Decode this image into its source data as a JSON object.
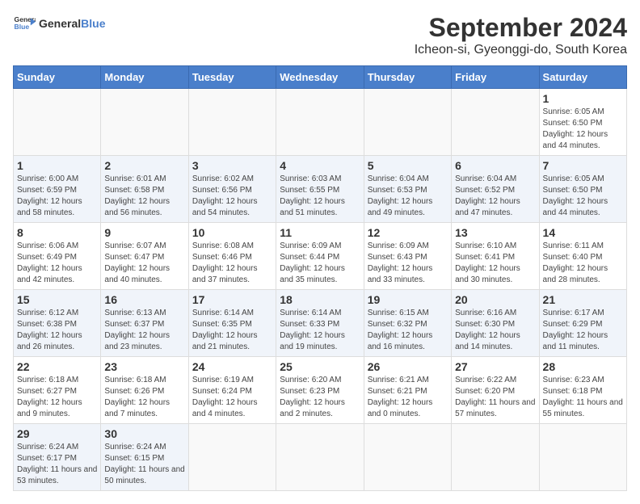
{
  "header": {
    "logo_line1": "General",
    "logo_line2": "Blue",
    "title": "September 2024",
    "subtitle": "Icheon-si, Gyeonggi-do, South Korea"
  },
  "calendar": {
    "days_of_week": [
      "Sunday",
      "Monday",
      "Tuesday",
      "Wednesday",
      "Thursday",
      "Friday",
      "Saturday"
    ],
    "weeks": [
      [
        {
          "day": "",
          "empty": true
        },
        {
          "day": "",
          "empty": true
        },
        {
          "day": "",
          "empty": true
        },
        {
          "day": "",
          "empty": true
        },
        {
          "day": "",
          "empty": true
        },
        {
          "day": "",
          "empty": true
        },
        {
          "day": "1",
          "sunrise": "Sunrise: 6:05 AM",
          "sunset": "Sunset: 6:50 PM",
          "daylight": "Daylight: 12 hours and 44 minutes."
        }
      ],
      [
        {
          "day": "1",
          "sunrise": "Sunrise: 6:00 AM",
          "sunset": "Sunset: 6:59 PM",
          "daylight": "Daylight: 12 hours and 58 minutes."
        },
        {
          "day": "2",
          "sunrise": "Sunrise: 6:01 AM",
          "sunset": "Sunset: 6:58 PM",
          "daylight": "Daylight: 12 hours and 56 minutes."
        },
        {
          "day": "3",
          "sunrise": "Sunrise: 6:02 AM",
          "sunset": "Sunset: 6:56 PM",
          "daylight": "Daylight: 12 hours and 54 minutes."
        },
        {
          "day": "4",
          "sunrise": "Sunrise: 6:03 AM",
          "sunset": "Sunset: 6:55 PM",
          "daylight": "Daylight: 12 hours and 51 minutes."
        },
        {
          "day": "5",
          "sunrise": "Sunrise: 6:04 AM",
          "sunset": "Sunset: 6:53 PM",
          "daylight": "Daylight: 12 hours and 49 minutes."
        },
        {
          "day": "6",
          "sunrise": "Sunrise: 6:04 AM",
          "sunset": "Sunset: 6:52 PM",
          "daylight": "Daylight: 12 hours and 47 minutes."
        },
        {
          "day": "7",
          "sunrise": "Sunrise: 6:05 AM",
          "sunset": "Sunset: 6:50 PM",
          "daylight": "Daylight: 12 hours and 44 minutes."
        }
      ],
      [
        {
          "day": "8",
          "sunrise": "Sunrise: 6:06 AM",
          "sunset": "Sunset: 6:49 PM",
          "daylight": "Daylight: 12 hours and 42 minutes."
        },
        {
          "day": "9",
          "sunrise": "Sunrise: 6:07 AM",
          "sunset": "Sunset: 6:47 PM",
          "daylight": "Daylight: 12 hours and 40 minutes."
        },
        {
          "day": "10",
          "sunrise": "Sunrise: 6:08 AM",
          "sunset": "Sunset: 6:46 PM",
          "daylight": "Daylight: 12 hours and 37 minutes."
        },
        {
          "day": "11",
          "sunrise": "Sunrise: 6:09 AM",
          "sunset": "Sunset: 6:44 PM",
          "daylight": "Daylight: 12 hours and 35 minutes."
        },
        {
          "day": "12",
          "sunrise": "Sunrise: 6:09 AM",
          "sunset": "Sunset: 6:43 PM",
          "daylight": "Daylight: 12 hours and 33 minutes."
        },
        {
          "day": "13",
          "sunrise": "Sunrise: 6:10 AM",
          "sunset": "Sunset: 6:41 PM",
          "daylight": "Daylight: 12 hours and 30 minutes."
        },
        {
          "day": "14",
          "sunrise": "Sunrise: 6:11 AM",
          "sunset": "Sunset: 6:40 PM",
          "daylight": "Daylight: 12 hours and 28 minutes."
        }
      ],
      [
        {
          "day": "15",
          "sunrise": "Sunrise: 6:12 AM",
          "sunset": "Sunset: 6:38 PM",
          "daylight": "Daylight: 12 hours and 26 minutes."
        },
        {
          "day": "16",
          "sunrise": "Sunrise: 6:13 AM",
          "sunset": "Sunset: 6:37 PM",
          "daylight": "Daylight: 12 hours and 23 minutes."
        },
        {
          "day": "17",
          "sunrise": "Sunrise: 6:14 AM",
          "sunset": "Sunset: 6:35 PM",
          "daylight": "Daylight: 12 hours and 21 minutes."
        },
        {
          "day": "18",
          "sunrise": "Sunrise: 6:14 AM",
          "sunset": "Sunset: 6:33 PM",
          "daylight": "Daylight: 12 hours and 19 minutes."
        },
        {
          "day": "19",
          "sunrise": "Sunrise: 6:15 AM",
          "sunset": "Sunset: 6:32 PM",
          "daylight": "Daylight: 12 hours and 16 minutes."
        },
        {
          "day": "20",
          "sunrise": "Sunrise: 6:16 AM",
          "sunset": "Sunset: 6:30 PM",
          "daylight": "Daylight: 12 hours and 14 minutes."
        },
        {
          "day": "21",
          "sunrise": "Sunrise: 6:17 AM",
          "sunset": "Sunset: 6:29 PM",
          "daylight": "Daylight: 12 hours and 11 minutes."
        }
      ],
      [
        {
          "day": "22",
          "sunrise": "Sunrise: 6:18 AM",
          "sunset": "Sunset: 6:27 PM",
          "daylight": "Daylight: 12 hours and 9 minutes."
        },
        {
          "day": "23",
          "sunrise": "Sunrise: 6:18 AM",
          "sunset": "Sunset: 6:26 PM",
          "daylight": "Daylight: 12 hours and 7 minutes."
        },
        {
          "day": "24",
          "sunrise": "Sunrise: 6:19 AM",
          "sunset": "Sunset: 6:24 PM",
          "daylight": "Daylight: 12 hours and 4 minutes."
        },
        {
          "day": "25",
          "sunrise": "Sunrise: 6:20 AM",
          "sunset": "Sunset: 6:23 PM",
          "daylight": "Daylight: 12 hours and 2 minutes."
        },
        {
          "day": "26",
          "sunrise": "Sunrise: 6:21 AM",
          "sunset": "Sunset: 6:21 PM",
          "daylight": "Daylight: 12 hours and 0 minutes."
        },
        {
          "day": "27",
          "sunrise": "Sunrise: 6:22 AM",
          "sunset": "Sunset: 6:20 PM",
          "daylight": "Daylight: 11 hours and 57 minutes."
        },
        {
          "day": "28",
          "sunrise": "Sunrise: 6:23 AM",
          "sunset": "Sunset: 6:18 PM",
          "daylight": "Daylight: 11 hours and 55 minutes."
        }
      ],
      [
        {
          "day": "29",
          "sunrise": "Sunrise: 6:24 AM",
          "sunset": "Sunset: 6:17 PM",
          "daylight": "Daylight: 11 hours and 53 minutes."
        },
        {
          "day": "30",
          "sunrise": "Sunrise: 6:24 AM",
          "sunset": "Sunset: 6:15 PM",
          "daylight": "Daylight: 11 hours and 50 minutes."
        },
        {
          "day": "",
          "empty": true
        },
        {
          "day": "",
          "empty": true
        },
        {
          "day": "",
          "empty": true
        },
        {
          "day": "",
          "empty": true
        },
        {
          "day": "",
          "empty": true
        }
      ]
    ]
  }
}
